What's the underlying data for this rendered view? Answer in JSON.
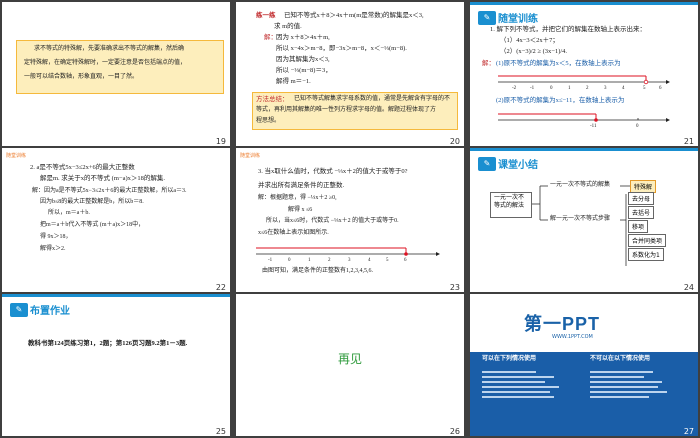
{
  "s19": {
    "num": "19",
    "text": [
      "求不等式的特殊解，先要准确求出不等式的解集，然后确",
      "定特殊解，在确定特殊解时，一定要注意是否包括端点的值，",
      "一般可以结合数轴，形象直观，一目了然。"
    ]
  },
  "s20": {
    "num": "20",
    "label": "练一练",
    "q": "已知不等式x＋8＞4x＋m(m是常数)的解集是x＜3,",
    "q2": "求 m的值.",
    "sol_label": "解：",
    "lines": [
      "因为 x＋8＞4x＋m,",
      "所以 x−4x＞m−8，即−3x＞m−8，x＜−⅓(m−8).",
      "因为其解集为x＜3,",
      "所以 −⅓(m−8)＝3，",
      "解得 m＝−1."
    ],
    "tip_label": "方法总结：",
    "tip": [
      "已知不等式解集求字母系数的值，通常是先解含有字母的不",
      "等式，再利用其解集的唯一性列方程求字母的值。解题过程体现了方",
      "程思想。"
    ]
  },
  "s21": {
    "num": "21",
    "title": "随堂训练",
    "q": "1. 解下列不等式，并把它们的解集在数轴上表示出来：",
    "p1": "（1）4x−3＜2x＋7；",
    "p2": "（2）(x−3)/2 ≥ (3x−1)/4.",
    "sol_label": "解：",
    "a1": "(1)原不等式的解集为x＜5，在数轴上表示为",
    "a2": "(2)原不等式的解集为x≤−11，在数轴上表示为",
    "ticks1": [
      "-2",
      "-1",
      "0",
      "1",
      "2",
      "3",
      "4",
      "5",
      "6"
    ],
    "ticks2": [
      "-11",
      "0"
    ]
  },
  "s22": {
    "num": "22",
    "label": "随堂训练",
    "lines": [
      "2. a是不等式5x−3≤2x+6的最大正整数",
      "解是b是不等式x²的最大正整数",
      "解是m. 求关于x的不等式 (m−a)x＞18的解集."
    ],
    "sol": [
      "解：因为a是不等式5x−3≤2x＋6的最大正整数解，所以a＝3.",
      "因为b≤8的最大正整数解是b，所以b＝8.",
      "所以，m＝a＋b.",
      "把m＝a＋b代入不等式 (m＋a)x＞18中，",
      "得 9x＞18，",
      "解得x＞2."
    ]
  },
  "s23": {
    "num": "23",
    "label": "随堂训练",
    "lines": [
      "3. 当x取什么值时，代数式 −⅓x＋2的值大于或等于0?",
      "并求出所有满足条件的正整数."
    ],
    "sol": [
      "解：根据题意，得 −⅓x＋2 ≥0,",
      "解得 x ≤6",
      "所以，当x≤6时，代数式 −⅓x＋2 的值大于或等于0.",
      "x≤6在数轴上表示如图所示."
    ],
    "ticks": [
      "-1",
      "0",
      "1",
      "2",
      "3",
      "4",
      "5",
      "6"
    ],
    "end": "由图可知，满足条件的正整数有1,2,3,4,5,6."
  },
  "s24": {
    "num": "24",
    "title": "课堂小结",
    "center": "一元一次不等式的解法",
    "top": "一元一次不等式的解集",
    "special": "特殊解",
    "bottom": "解一元一次不等式步骤",
    "steps": [
      "去分母",
      "去括号",
      "移项",
      "合并同类项",
      "系数化为1"
    ]
  },
  "s25": {
    "num": "25",
    "title": "布置作业",
    "text": "教科书第124页练习第1，2题；第126页习题9.2第1－3题."
  },
  "s26": {
    "num": "26",
    "text": "再见"
  },
  "s27": {
    "num": "27",
    "brand": "第一PPT",
    "url": "WWW.1PPT.COM",
    "left_h": "可以在下列情况使用",
    "right_h": "不可以在以下情况使用"
  }
}
